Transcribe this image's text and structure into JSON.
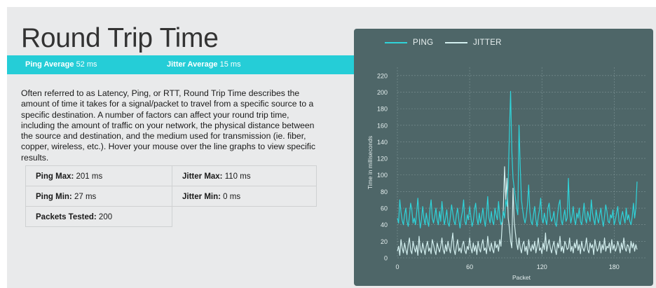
{
  "header": {
    "title": "Round Trip Time"
  },
  "summary": {
    "ping_label": "Ping Average",
    "ping_value": "52 ms",
    "jitter_label": "Jitter Average",
    "jitter_value": "15 ms"
  },
  "description": "Often referred to as Latency, Ping, or RTT, Round Trip Time describes the amount of time it takes for a signal/packet to travel from a specific source to a specific destination. A number of factors can affect your round trip time, including the amount of traffic on your network, the physical distance between the source and destination, and the medium used for transmission (ie. fiber, copper, wireless, etc.). Hover your mouse over the line graphs to view specific results.",
  "metrics": {
    "ping_max_label": "Ping Max:",
    "ping_max_value": "201 ms",
    "jitter_max_label": "Jitter Max:",
    "jitter_max_value": "110 ms",
    "ping_min_label": "Ping Min:",
    "ping_min_value": "27 ms",
    "jitter_min_label": "Jitter Min:",
    "jitter_min_value": "0 ms",
    "packets_label": "Packets Tested:",
    "packets_value": "200"
  },
  "colors": {
    "accent": "#25cdd7",
    "ping_line": "#2fd3d9",
    "jitter_line": "#d2eeee",
    "chart_bg": "#4e6668",
    "page_bg": "#e9eaeb"
  },
  "chart_data": {
    "type": "line",
    "title": "",
    "xlabel": "Packet",
    "ylabel": "Time in milliseconds",
    "xlim": [
      0,
      206
    ],
    "ylim": [
      0,
      230
    ],
    "x_ticks": [
      0,
      60,
      120,
      180
    ],
    "y_ticks": [
      0,
      20,
      40,
      60,
      80,
      100,
      120,
      140,
      160,
      180,
      200,
      220
    ],
    "grid": true,
    "legend_position": "top-left",
    "series": [
      {
        "name": "PING",
        "color": "#2fd3d9",
        "values": [
          48,
          42,
          70,
          55,
          45,
          40,
          52,
          60,
          44,
          38,
          50,
          66,
          58,
          42,
          48,
          40,
          55,
          72,
          50,
          36,
          46,
          62,
          48,
          40,
          54,
          44,
          38,
          58,
          70,
          48,
          42,
          50,
          60,
          46,
          40,
          56,
          44,
          68,
          52,
          40,
          48,
          58,
          42,
          38,
          50,
          64,
          54,
          44,
          40,
          52,
          60,
          46,
          36,
          48,
          56,
          70,
          44,
          40,
          52,
          46,
          62,
          50,
          38,
          44,
          58,
          66,
          48,
          40,
          54,
          42,
          50,
          60,
          46,
          38,
          52,
          74,
          48,
          42,
          56,
          44,
          40,
          60,
          52,
          46,
          68,
          50,
          40,
          44,
          56,
          48,
          70,
          62,
          92,
          150,
          201,
          130,
          96,
          84,
          72,
          60,
          52,
          160,
          110,
          70,
          58,
          48,
          42,
          50,
          64,
          88,
          56,
          44,
          40,
          52,
          62,
          46,
          38,
          50,
          58,
          72,
          48,
          42,
          54,
          46,
          40,
          60,
          66,
          50,
          44,
          48,
          56,
          42,
          38,
          52,
          64,
          70,
          46,
          40,
          50,
          58,
          44,
          48,
          96,
          56,
          42,
          50,
          62,
          46,
          40,
          54,
          48,
          60,
          44,
          40,
          52,
          66,
          48,
          42,
          56,
          50,
          44,
          70,
          54,
          46,
          40,
          58,
          48,
          42,
          52,
          60,
          46,
          38,
          50,
          64,
          56,
          44,
          42,
          52,
          48,
          58,
          40,
          46,
          54,
          62,
          44,
          40,
          50,
          56,
          48,
          42,
          60,
          46,
          52,
          44,
          40,
          50,
          66,
          48,
          60,
          92
        ]
      },
      {
        "name": "JITTER",
        "color": "#d2eeee",
        "values": [
          8,
          14,
          3,
          22,
          12,
          6,
          18,
          10,
          4,
          16,
          24,
          9,
          5,
          20,
          12,
          7,
          15,
          3,
          26,
          10,
          6,
          18,
          11,
          4,
          14,
          20,
          8,
          12,
          5,
          22,
          16,
          9,
          4,
          18,
          12,
          7,
          14,
          24,
          10,
          5,
          16,
          8,
          20,
          12,
          6,
          18,
          30,
          10,
          4,
          14,
          22,
          8,
          12,
          6,
          16,
          20,
          9,
          5,
          14,
          10,
          24,
          12,
          6,
          18,
          8,
          15,
          4,
          20,
          11,
          7,
          16,
          22,
          9,
          12,
          5,
          26,
          14,
          8,
          18,
          10,
          6,
          20,
          12,
          16,
          8,
          22,
          14,
          40,
          60,
          110,
          70,
          96,
          48,
          36,
          20,
          12,
          84,
          44,
          30,
          18,
          10,
          24,
          12,
          6,
          16,
          20,
          8,
          14,
          4,
          22,
          12,
          8,
          16,
          10,
          20,
          6,
          14,
          24,
          9,
          12,
          5,
          18,
          10,
          30,
          8,
          16,
          22,
          12,
          6,
          14,
          20,
          10,
          4,
          18,
          12,
          26,
          8,
          14,
          6,
          20,
          16,
          10,
          12,
          24,
          8,
          14,
          6,
          18,
          12,
          22,
          9,
          16,
          5,
          20,
          12,
          8,
          14,
          24,
          10,
          6,
          18,
          12,
          16,
          4,
          22,
          14,
          8,
          12,
          20,
          6,
          16,
          10,
          24,
          8,
          14,
          12,
          18,
          6,
          22,
          10,
          16,
          8,
          12,
          20,
          14,
          6,
          18,
          10,
          24,
          12,
          8,
          16,
          14,
          6,
          20,
          12,
          18,
          8,
          16,
          10
        ]
      }
    ]
  }
}
